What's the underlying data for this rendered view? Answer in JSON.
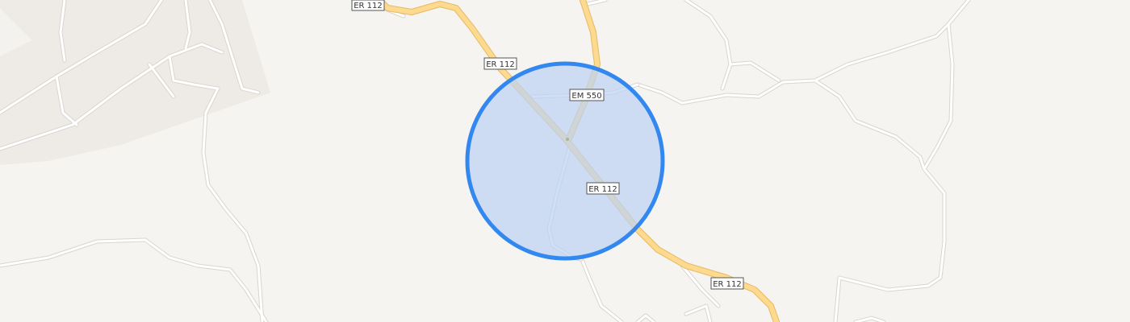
{
  "map": {
    "road_labels": {
      "er112_top": "ER 112",
      "er112_mid": "ER 112",
      "er112_center": "ER 112",
      "er112_bottom": "ER 112",
      "em550": "EM 550"
    },
    "colors": {
      "background": "#f6f4f0",
      "urban_area": "#eeebe6",
      "minor_road": "#ffffff",
      "minor_road_casing": "#dcd8d2",
      "primary_road": "#fdd98a",
      "primary_road_casing": "#e8b86a",
      "accuracy_fill": "#cfddf3",
      "accuracy_stroke": "#3388f0"
    },
    "icons": [
      "location-accuracy-circle"
    ]
  }
}
